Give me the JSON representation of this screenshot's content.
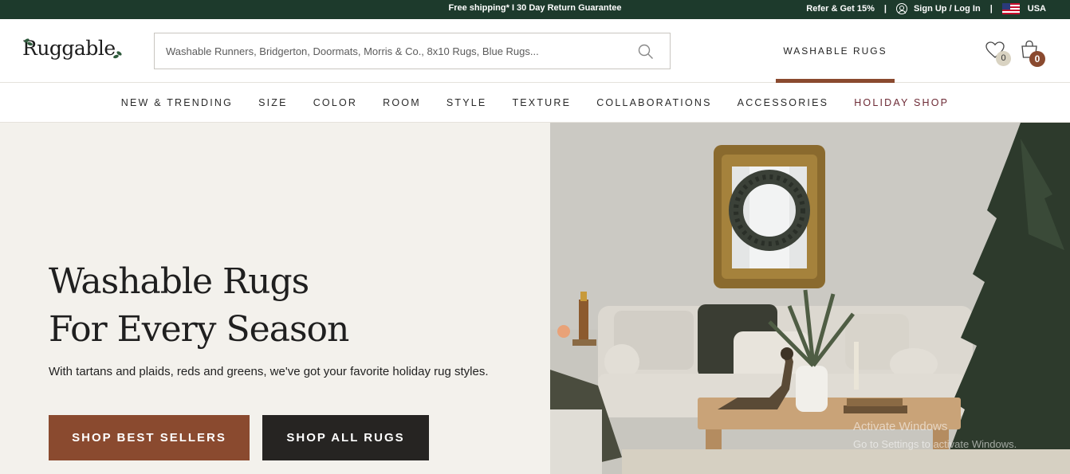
{
  "topbar": {
    "promo": "Free shipping* I 30 Day Return Guarantee",
    "refer": "Refer & Get 15%",
    "signup": "Sign Up / Log In",
    "country": "USA",
    "separator": "|"
  },
  "header": {
    "logo": "Ruggable",
    "search_placeholder": "Washable Runners, Bridgerton, Doormats, Morris & Co., 8x10 Rugs, Blue Rugs...",
    "washable_tab": "WASHABLE RUGS",
    "wishlist_count": "0",
    "cart_count": "0"
  },
  "nav": {
    "items": [
      "NEW & TRENDING",
      "SIZE",
      "COLOR",
      "ROOM",
      "STYLE",
      "TEXTURE",
      "COLLABORATIONS",
      "ACCESSORIES",
      "HOLIDAY SHOP"
    ]
  },
  "hero": {
    "title_line1": "Washable Rugs",
    "title_line2": "For Every Season",
    "subtitle": "With tartans and plaids, reds and greens, we've got your favorite holiday rug styles.",
    "btn_best": "SHOP BEST SELLERS",
    "btn_all": "SHOP ALL RUGS"
  },
  "watermark": {
    "line1": "Activate Windows",
    "line2": "Go to Settings to activate Windows."
  },
  "colors": {
    "topbar_bg": "#1d3a2c",
    "accent_brown": "#8a4a2f",
    "dark_button": "#262422",
    "holiday_text": "#6d2a35",
    "hero_bg": "#f3f1ec"
  }
}
